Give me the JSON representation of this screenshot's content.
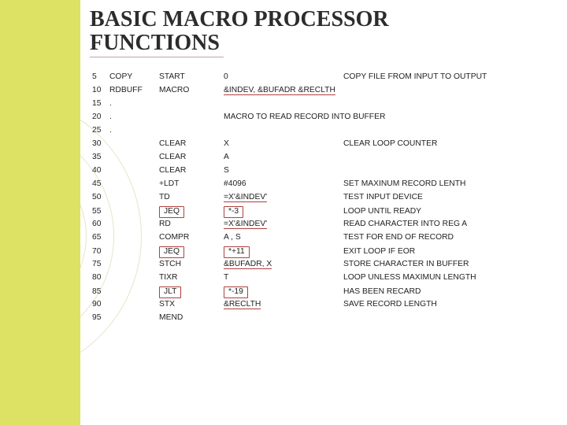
{
  "title_line1": "BASIC MACRO PROCESSOR",
  "title_line2": "FUNCTIONS",
  "rows": [
    {
      "n": "5",
      "lbl": "COPY",
      "op": "START",
      "arg": "0",
      "cmt": "COPY FILE FROM INPUT TO OUTPUT",
      "opBox": false,
      "argBox": false,
      "argUnder": false
    },
    {
      "n": "10",
      "lbl": "RDBUFF",
      "op": "MACRO",
      "arg": "&INDEV, &BUFADR &RECLTH",
      "cmt": "",
      "opBox": false,
      "argBox": false,
      "argUnder": true
    },
    {
      "n": "15",
      "lbl": ".",
      "op": "",
      "arg": "",
      "cmt": "",
      "opBox": false,
      "argBox": false,
      "argUnder": false
    },
    {
      "n": "20",
      "lbl": ".",
      "op": "",
      "arg": "MACRO TO READ RECORD INTO BUFFER",
      "cmt": "",
      "opBox": false,
      "argBox": false,
      "argUnder": false
    },
    {
      "n": "25",
      "lbl": ".",
      "op": "",
      "arg": "",
      "cmt": "",
      "opBox": false,
      "argBox": false,
      "argUnder": false
    },
    {
      "n": "30",
      "lbl": "",
      "op": "CLEAR",
      "arg": "X",
      "cmt": "CLEAR LOOP COUNTER",
      "opBox": false,
      "argBox": false,
      "argUnder": false
    },
    {
      "n": "35",
      "lbl": "",
      "op": "CLEAR",
      "arg": "A",
      "cmt": "",
      "opBox": false,
      "argBox": false,
      "argUnder": false
    },
    {
      "n": "40",
      "lbl": "",
      "op": "CLEAR",
      "arg": "S",
      "cmt": "",
      "opBox": false,
      "argBox": false,
      "argUnder": false
    },
    {
      "n": "45",
      "lbl": "",
      "op": "+LDT",
      "arg": "#4096",
      "cmt": "SET MAXINUM RECORD LENTH",
      "opBox": false,
      "argBox": false,
      "argUnder": false
    },
    {
      "n": "50",
      "lbl": "",
      "op": "TD",
      "arg": "=X'&INDEV'",
      "cmt": "TEST INPUT DEVICE",
      "opBox": false,
      "argBox": false,
      "argUnder": true
    },
    {
      "n": "55",
      "lbl": "",
      "op": "JEQ",
      "arg": "*-3",
      "cmt": "LOOP UNTIL READY",
      "opBox": true,
      "argBox": true,
      "argUnder": false
    },
    {
      "n": "60",
      "lbl": "",
      "op": "RD",
      "arg": "=X'&INDEV'",
      "cmt": "READ CHARACTER INTO REG A",
      "opBox": false,
      "argBox": false,
      "argUnder": true
    },
    {
      "n": "65",
      "lbl": "",
      "op": "COMPR",
      "arg": "A , S",
      "cmt": "TEST FOR END OF RECORD",
      "opBox": false,
      "argBox": false,
      "argUnder": false
    },
    {
      "n": "70",
      "lbl": "",
      "op": "JEQ",
      "arg": "*+11",
      "cmt": "EXIT LOOP IF EOR",
      "opBox": true,
      "argBox": true,
      "argUnder": false
    },
    {
      "n": "75",
      "lbl": "",
      "op": "STCH",
      "arg": "&BUFADR, X",
      "cmt": "STORE CHARACTER IN BUFFER",
      "opBox": false,
      "argBox": false,
      "argUnder": true
    },
    {
      "n": "80",
      "lbl": "",
      "op": "TIXR",
      "arg": "T",
      "cmt": "LOOP UNLESS MAXIMUN LENGTH",
      "opBox": false,
      "argBox": false,
      "argUnder": false
    },
    {
      "n": "85",
      "lbl": "",
      "op": "JLT",
      "arg": "*-19",
      "cmt": "HAS BEEN RECARD",
      "opBox": true,
      "argBox": true,
      "argUnder": false
    },
    {
      "n": "90",
      "lbl": "",
      "op": "STX",
      "arg": "&RECLTH",
      "cmt": "SAVE RECORD LENGTH",
      "opBox": false,
      "argBox": false,
      "argUnder": true
    },
    {
      "n": "95",
      "lbl": "",
      "op": "MEND",
      "arg": "",
      "cmt": "",
      "opBox": false,
      "argBox": false,
      "argUnder": false
    }
  ]
}
